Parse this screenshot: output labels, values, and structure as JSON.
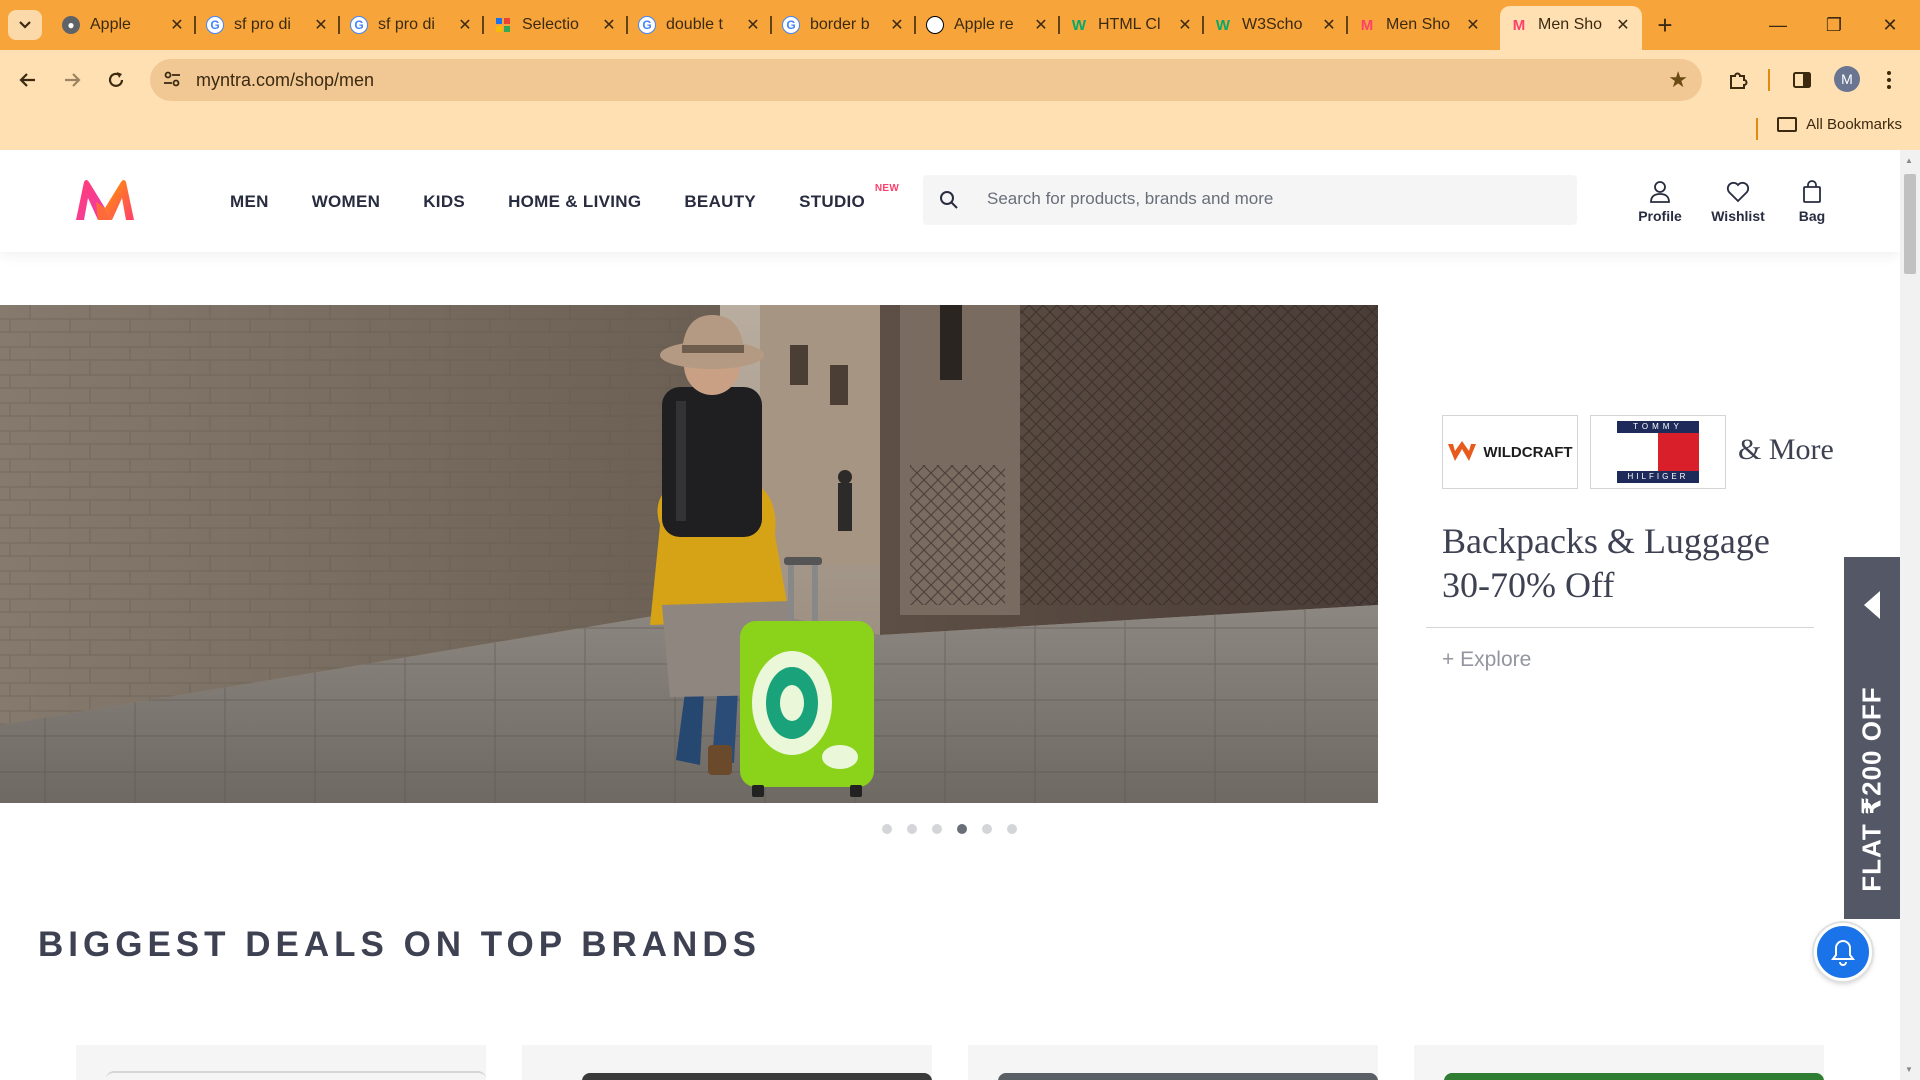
{
  "browser": {
    "tabs": [
      {
        "title": "Apple",
        "favicon": "apple-circle-icon",
        "favicon_color": "#5f6368"
      },
      {
        "title": "sf pro di",
        "favicon": "google-g-icon",
        "favicon_color": "#4285f4"
      },
      {
        "title": "sf pro di",
        "favicon": "google-g-icon",
        "favicon_color": "#4285f4"
      },
      {
        "title": "Selectio",
        "favicon": "selection-grid-icon",
        "favicon_color": "#1a73e8"
      },
      {
        "title": "double t",
        "favicon": "google-g-icon",
        "favicon_color": "#4285f4"
      },
      {
        "title": "border b",
        "favicon": "google-g-icon",
        "favicon_color": "#4285f4"
      },
      {
        "title": "Apple re",
        "favicon": "apple-logo-icon",
        "favicon_color": "#000000"
      },
      {
        "title": "HTML Cl",
        "favicon": "w3schools-icon",
        "favicon_color": "#04aa6d"
      },
      {
        "title": "W3Scho",
        "favicon": "w3schools-icon",
        "favicon_color": "#04aa6d"
      },
      {
        "title": "Men Sho",
        "favicon": "myntra-icon",
        "favicon_color": "#ff3f6c"
      },
      {
        "title": "Men Sho",
        "favicon": "myntra-icon",
        "favicon_color": "#ff3f6c",
        "active": true
      }
    ],
    "url": "myntra.com/shop/men",
    "profile_initial": "M",
    "bookmarks_label": "All Bookmarks",
    "colors": {
      "tabstrip": "#f7a53b",
      "toolbar": "#ffe0b3"
    }
  },
  "site": {
    "brand": "Myntra",
    "nav": [
      {
        "label": "MEN"
      },
      {
        "label": "WOMEN"
      },
      {
        "label": "KIDS"
      },
      {
        "label": "HOME & LIVING"
      },
      {
        "label": "BEAUTY"
      },
      {
        "label": "STUDIO",
        "badge": "NEW"
      }
    ],
    "search_placeholder": "Search for products, brands and more",
    "actions": {
      "profile": "Profile",
      "wishlist": "Wishlist",
      "bag": "Bag"
    },
    "colors": {
      "accent": "#ff3f6c",
      "text": "#282c3f"
    }
  },
  "banner": {
    "brands": [
      "WILDCRAFT",
      "TOMMY",
      "HILFIGER"
    ],
    "more": "& More",
    "title_line1": "Backpacks & Luggage",
    "title_line2": "30-70% Off",
    "cta": "+ Explore",
    "slides_total": 6,
    "active_slide": 4
  },
  "section": {
    "title": "BIGGEST DEALS ON TOP BRANDS"
  },
  "floating": {
    "offer": "FLAT ₹200 OFF"
  }
}
